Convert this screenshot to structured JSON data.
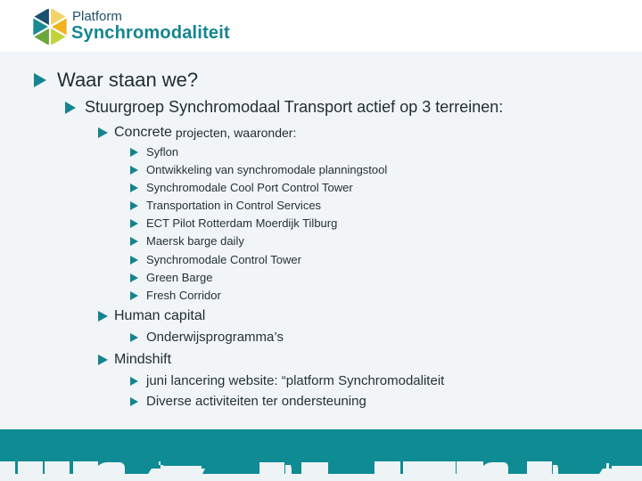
{
  "header": {
    "logo_line1": "Platform",
    "logo_line2": "Synchromodaliteit",
    "logo_colors": [
      "#1d4f6e",
      "#f4d36b",
      "#1a8a95",
      "#f1b21f",
      "#6aa63b",
      "#c2d23b"
    ]
  },
  "slide": {
    "level1": "Waar staan we?",
    "level2": "Stuurgroep Synchromodaal Transport actief op 3 terreinen:",
    "sections": [
      {
        "title": "Concrete",
        "subtitle": "projecten, waaronder:",
        "items": [
          "Syflon",
          "Ontwikkeling van synchromodale planningstool",
          "Synchromodale Cool Port Control Tower",
          "Transportation in Control Services",
          "ECT Pilot Rotterdam Moerdijk Tilburg",
          "Maersk barge daily",
          "Synchromodale Control Tower",
          "Green Barge",
          "Fresh Corridor"
        ]
      },
      {
        "title": "Human capital",
        "items": [
          "Onderwijsprogramma’s"
        ]
      },
      {
        "title": "Mindshift",
        "items": [
          "juni lancering website: “platform Synchromodaliteit",
          "Diverse activiteiten ter ondersteuning"
        ]
      }
    ]
  },
  "footer": {
    "band_color": "#0f8b94",
    "vehicle_color": "#eef3f5",
    "vehicles": [
      "train",
      "tank-wagon",
      "container-ship",
      "truck",
      "train",
      "tank-wagon",
      "truck",
      "container-ship"
    ]
  }
}
